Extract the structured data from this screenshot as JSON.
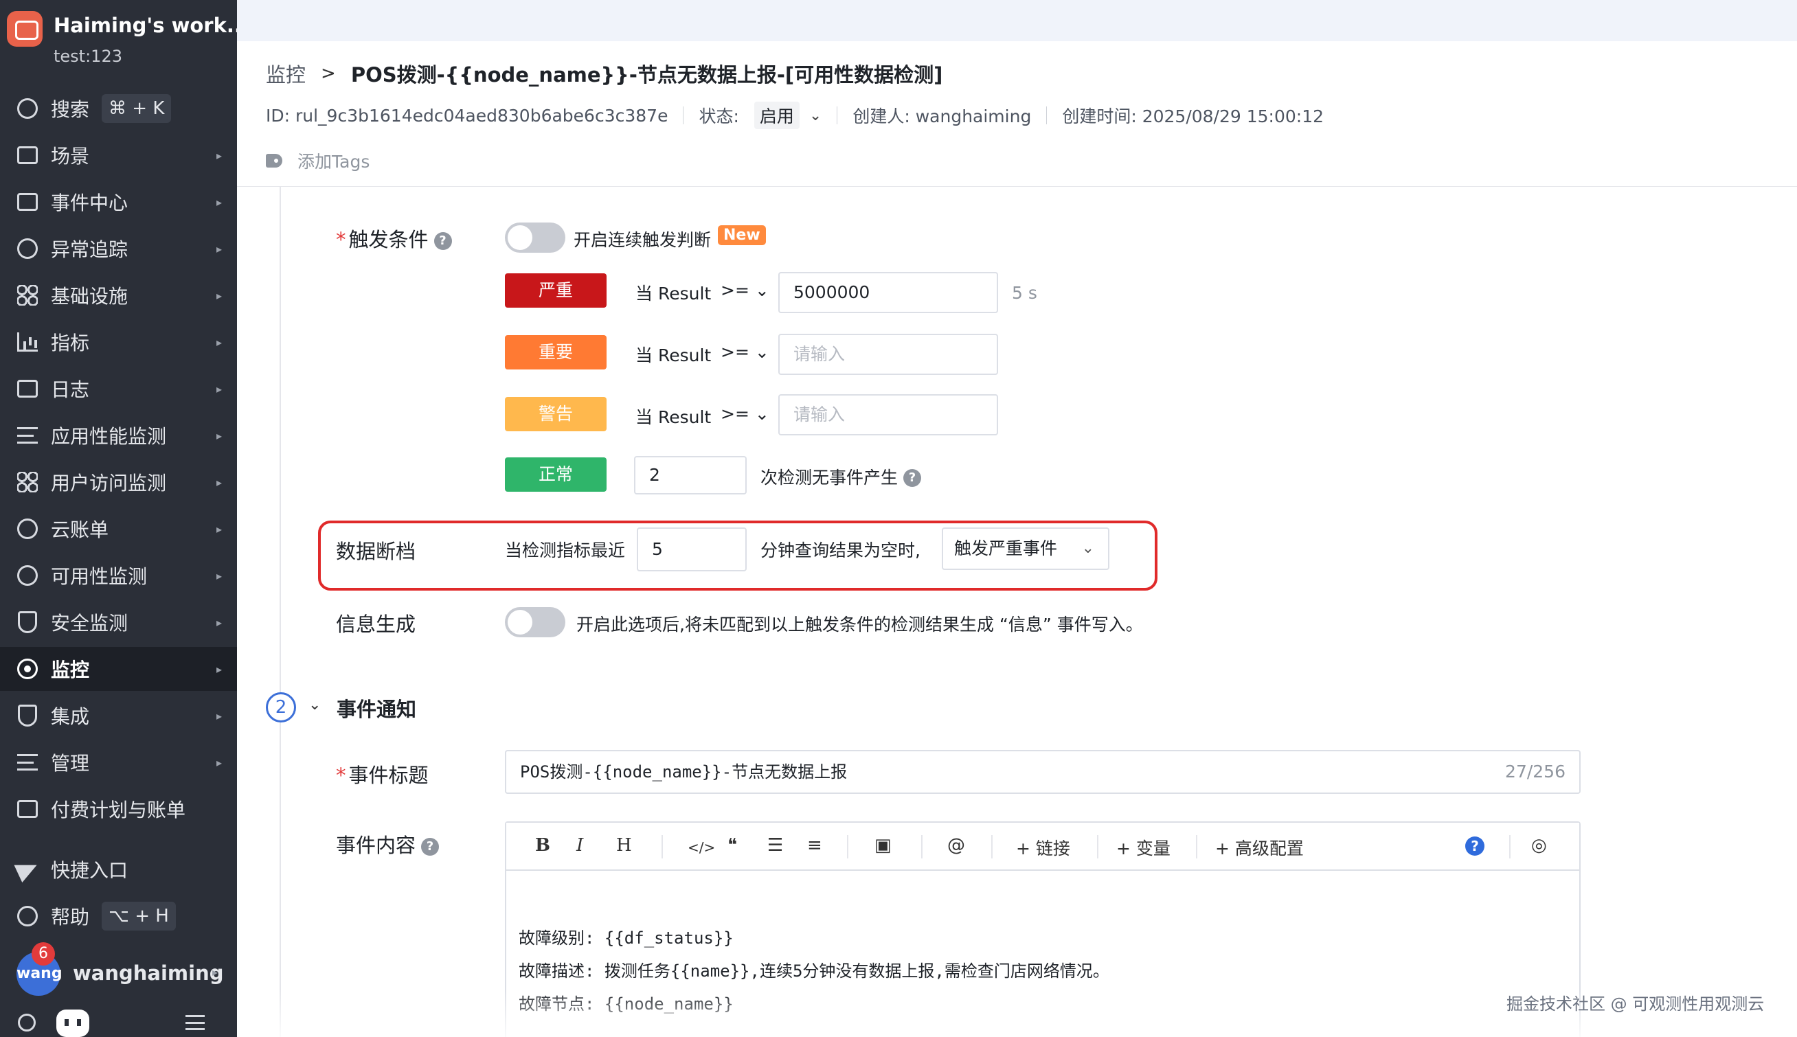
{
  "workspace": {
    "name": "Haiming's work...",
    "sub": "test:123"
  },
  "sidebar": {
    "search": {
      "label": "搜索",
      "shortcut": "⌘ + K"
    },
    "items": [
      {
        "label": "场景"
      },
      {
        "label": "事件中心"
      },
      {
        "label": "异常追踪"
      },
      {
        "label": "基础设施"
      },
      {
        "label": "指标"
      },
      {
        "label": "日志"
      },
      {
        "label": "应用性能监测"
      },
      {
        "label": "用户访问监测"
      },
      {
        "label": "云账单"
      },
      {
        "label": "可用性监测"
      },
      {
        "label": "安全监测"
      },
      {
        "label": "监控"
      },
      {
        "label": "集成"
      },
      {
        "label": "管理"
      },
      {
        "label": "付费计划与账单"
      }
    ],
    "shortcut_entry": "快捷入口",
    "help": {
      "label": "帮助",
      "shortcut": "⌥ + H"
    },
    "user": {
      "avatar_text": "wang",
      "badge": "6",
      "name": "wanghaiming"
    }
  },
  "header": {
    "breadcrumb_root": "监控",
    "breadcrumb_current": "POS拨测-{{node_name}}-节点无数据上报-[可用性数据检测]",
    "id_text": "ID: rul_9c3b1614edc04aed830b6abe6c3c387e",
    "status_label": "状态:",
    "status_value": "启用",
    "creator": "创建人: wanghaiming",
    "created_time": "创建时间: 2025/08/29 15:00:12",
    "add_tags": "添加Tags"
  },
  "trigger": {
    "label": "触发条件",
    "continuous_label": "开启连续触发判断",
    "new_badge": "New",
    "rules": [
      {
        "level": "严重",
        "color": "#c8171a",
        "cond": "当 Result",
        "op": ">=",
        "value": "5000000",
        "placeholder": "",
        "unit": "5 s"
      },
      {
        "level": "重要",
        "color": "#ff7a33",
        "cond": "当 Result",
        "op": ">=",
        "value": "",
        "placeholder": "请输入",
        "unit": ""
      },
      {
        "level": "警告",
        "color": "#ffb84d",
        "cond": "当 Result",
        "op": ">=",
        "value": "",
        "placeholder": "请输入",
        "unit": ""
      }
    ],
    "normal": {
      "level": "正常",
      "color": "#2fb56a",
      "value": "2",
      "suffix": "次检测无事件产生"
    }
  },
  "data_gap": {
    "label": "数据断档",
    "prefix": "当检测指标最近",
    "minutes": "5",
    "suffix": "分钟查询结果为空时,",
    "action": "触发严重事件"
  },
  "info_gen": {
    "label": "信息生成",
    "desc": "开启此选项后,将未匹配到以上触发条件的检测结果生成 “信息” 事件写入。"
  },
  "notify": {
    "step": "2",
    "title": "事件通知",
    "event_title_label": "事件标题",
    "event_title_value": "POS拨测-{{node_name}}-节点无数据上报",
    "event_title_count": "27/256",
    "event_content_label": "事件内容",
    "toolbar": {
      "bold": "B",
      "italic": "I",
      "heading": "H",
      "code": "</>",
      "quote": "❝",
      "ul": "☰",
      "ol": "≡",
      "image": "▣",
      "mention": "@",
      "link": "链接",
      "variable": "变量",
      "advanced": "高级配置",
      "help": "?",
      "preview": "◎"
    },
    "content_lines": [
      "故障级别: {{df_status}}",
      "故障描述: 拨测任务{{name}},连续5分钟没有数据上报,需检查门店网络情况。",
      "故障节点: {{node_name}}"
    ]
  },
  "watermark": "掘金技术社区 @ 可观测性用观测云"
}
